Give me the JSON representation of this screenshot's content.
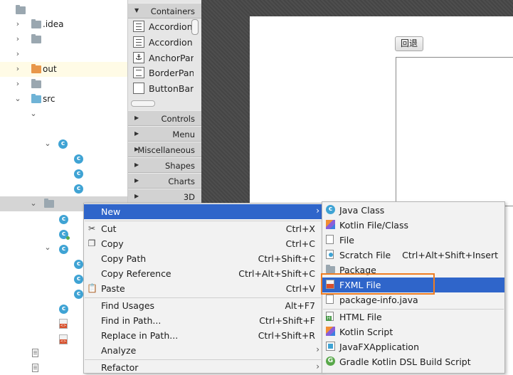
{
  "tree": {
    "items": [
      {
        "label": ".idea"
      },
      {
        "label": "out"
      },
      {
        "label": "src"
      }
    ]
  },
  "library": {
    "sections": {
      "containers": "Containers",
      "controls": "Controls",
      "menu": "Menu",
      "miscellaneous": "Miscellaneous",
      "shapes": "Shapes",
      "charts": "Charts",
      "three_d": "3D"
    },
    "items": [
      "Accordion",
      "Accordion",
      "AnchorPane",
      "BorderPane",
      "ButtonBar"
    ]
  },
  "editor": {
    "back_button_label": "回退"
  },
  "context_menu": {
    "new": "New",
    "cut": "Cut",
    "cut_shortcut": "Ctrl+X",
    "copy": "Copy",
    "copy_shortcut": "Ctrl+C",
    "copy_path": "Copy Path",
    "copy_path_shortcut": "Ctrl+Shift+C",
    "copy_reference": "Copy Reference",
    "copy_reference_shortcut": "Ctrl+Alt+Shift+C",
    "paste": "Paste",
    "paste_shortcut": "Ctrl+V",
    "find_usages": "Find Usages",
    "find_usages_shortcut": "Alt+F7",
    "find_in_path": "Find in Path...",
    "find_in_path_shortcut": "Ctrl+Shift+F",
    "replace_in_path": "Replace in Path...",
    "replace_in_path_shortcut": "Ctrl+Shift+R",
    "analyze": "Analyze",
    "refactor": "Refactor"
  },
  "new_submenu": {
    "java_class": "Java Class",
    "kotlin_file_class": "Kotlin File/Class",
    "file": "File",
    "scratch_file": "Scratch File",
    "scratch_file_shortcut": "Ctrl+Alt+Shift+Insert",
    "package": "Package",
    "fxml_file": "FXML File",
    "package_info": "package-info.java",
    "html_file": "HTML File",
    "kotlin_script": "Kotlin Script",
    "javafx_application": "JavaFXApplication",
    "gradle_kotlin_dsl_build_script": "Gradle Kotlin DSL Build Script"
  },
  "colors": {
    "selection": "#2f65ca",
    "highlight_border": "#ef7d22",
    "menu_background": "#f2f2f2",
    "canvas_background": "#4a4a4a"
  }
}
